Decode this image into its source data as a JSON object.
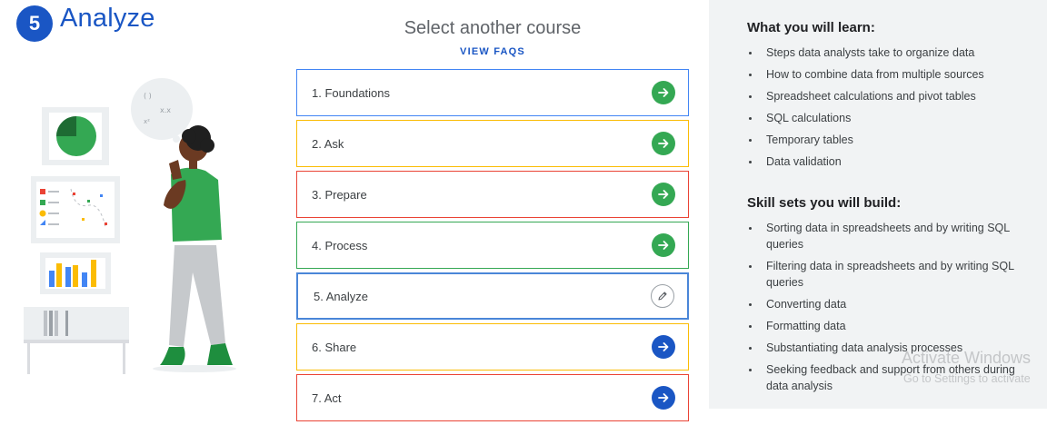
{
  "header": {
    "step_number": "5",
    "title": "Analyze"
  },
  "courses": {
    "heading": "Select another course",
    "faq_label": "VIEW FAQS",
    "items": [
      {
        "label": "1. Foundations",
        "border_color": "#4285f4",
        "icon": "arrow-right-icon",
        "icon_color": "#34a853",
        "state": "completed"
      },
      {
        "label": "2. Ask",
        "border_color": "#fbbc04",
        "icon": "arrow-right-icon",
        "icon_color": "#34a853",
        "state": "completed"
      },
      {
        "label": "3. Prepare",
        "border_color": "#ea4335",
        "icon": "arrow-right-icon",
        "icon_color": "#34a853",
        "state": "completed"
      },
      {
        "label": "4. Process",
        "border_color": "#34a853",
        "icon": "arrow-right-icon",
        "icon_color": "#34a853",
        "state": "completed"
      },
      {
        "label": "5. Analyze",
        "border_color": "#4a86d8",
        "icon": "pencil-icon",
        "icon_color": "#5f6368",
        "state": "current"
      },
      {
        "label": "6. Share",
        "border_color": "#fbbc04",
        "icon": "arrow-right-icon",
        "icon_color": "#1a56c4",
        "state": "upcoming"
      },
      {
        "label": "7. Act",
        "border_color": "#ea4335",
        "icon": "arrow-right-icon",
        "icon_color": "#1a56c4",
        "state": "upcoming"
      }
    ]
  },
  "learn": {
    "title": "What you will learn:",
    "items": [
      "Steps data analysts take to organize data",
      "How to combine data from multiple sources",
      "Spreadsheet calculations and pivot tables",
      "SQL calculations",
      "Temporary tables",
      "Data validation"
    ]
  },
  "skills": {
    "title": "Skill sets you will build:",
    "items": [
      "Sorting data in spreadsheets and by writing SQL queries",
      "Filtering data in spreadsheets and by writing SQL queries",
      "Converting data",
      "Formatting data",
      "Substantiating data analysis processes",
      "Seeking feedback and support from others during data analysis"
    ]
  },
  "watermark": {
    "line1": "Activate Windows",
    "line2": "Go to Settings to activate"
  },
  "colors": {
    "brand_blue": "#1a56c4",
    "green": "#34a853",
    "panel_bg": "#f1f3f4"
  }
}
